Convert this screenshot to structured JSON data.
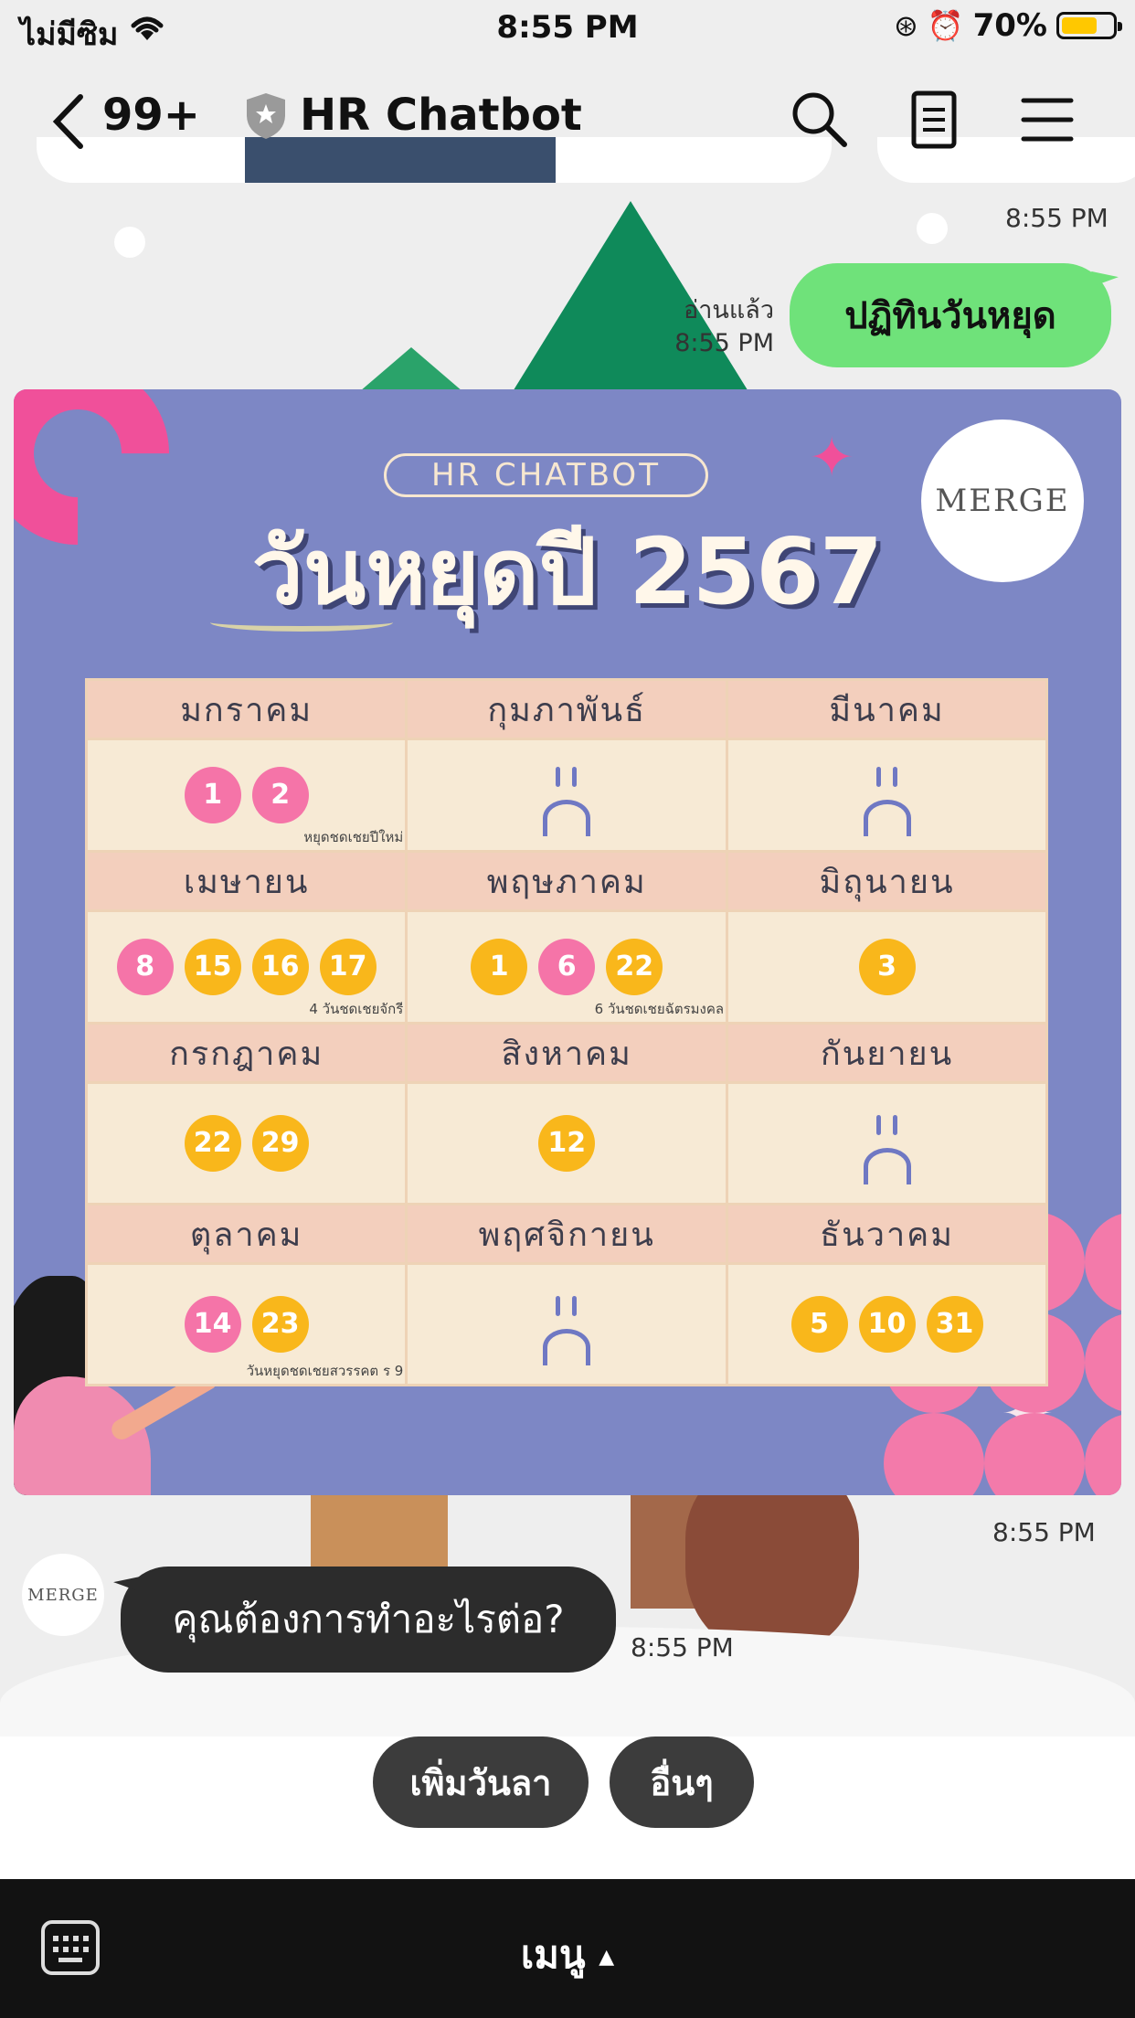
{
  "status_bar": {
    "carrier": "ไม่มีซิม",
    "time": "8:55 PM",
    "battery": "70%",
    "battery_level": 0.7
  },
  "header": {
    "unread_count": "99+",
    "title": "HR Chatbot",
    "icons": [
      "back-icon",
      "shield-icon",
      "search-icon",
      "notes-icon",
      "menu-icon"
    ]
  },
  "chat": {
    "timestamp_top": "8:55 PM",
    "outgoing": {
      "text": "ปฏิทินวันหยุด",
      "read_label": "อ่านแล้ว",
      "time": "8:55 PM"
    },
    "image_time": "8:55 PM",
    "calendar": {
      "badge": "HR CHATBOT",
      "title": "วันหยุดปี 2567",
      "logo": "MERGE",
      "months": [
        {
          "name": "มกราคม",
          "days": [
            {
              "d": "1",
              "c": "pink"
            },
            {
              "d": "2",
              "c": "pink"
            }
          ],
          "note": "หยุดชดเชยปีใหม่"
        },
        {
          "name": "กุมภาพันธ์",
          "days": [],
          "note": ""
        },
        {
          "name": "มีนาคม",
          "days": [],
          "note": ""
        },
        {
          "name": "เมษายน",
          "days": [
            {
              "d": "8",
              "c": "pink"
            },
            {
              "d": "15",
              "c": "yellow"
            },
            {
              "d": "16",
              "c": "yellow"
            },
            {
              "d": "17",
              "c": "yellow"
            }
          ],
          "note": "4 วันชดเชยจักรี"
        },
        {
          "name": "พฤษภาคม",
          "days": [
            {
              "d": "1",
              "c": "yellow"
            },
            {
              "d": "6",
              "c": "pink"
            },
            {
              "d": "22",
              "c": "yellow"
            }
          ],
          "note": "6 วันชดเชยฉัตรมงคล"
        },
        {
          "name": "มิถุนายน",
          "days": [
            {
              "d": "3",
              "c": "yellow"
            }
          ],
          "note": ""
        },
        {
          "name": "กรกฎาคม",
          "days": [
            {
              "d": "22",
              "c": "yellow"
            },
            {
              "d": "29",
              "c": "yellow"
            }
          ],
          "note": ""
        },
        {
          "name": "สิงหาคม",
          "days": [
            {
              "d": "12",
              "c": "yellow"
            }
          ],
          "note": ""
        },
        {
          "name": "กันยายน",
          "days": [],
          "note": ""
        },
        {
          "name": "ตุลาคม",
          "days": [
            {
              "d": "14",
              "c": "pink"
            },
            {
              "d": "23",
              "c": "yellow"
            }
          ],
          "note": "วันหยุดชดเชยสวรรคต ร 9"
        },
        {
          "name": "พฤศจิกายน",
          "days": [],
          "note": ""
        },
        {
          "name": "ธันวาคม",
          "days": [
            {
              "d": "5",
              "c": "yellow"
            },
            {
              "d": "10",
              "c": "yellow"
            },
            {
              "d": "31",
              "c": "yellow"
            }
          ],
          "note": ""
        }
      ]
    },
    "incoming": {
      "avatar_text": "MERGE",
      "text": "คุณต้องการทำอะไรต่อ?",
      "time": "8:55 PM"
    }
  },
  "quick_replies": [
    "เพิ่มวันลา",
    "อื่นๆ"
  ],
  "bottom_bar": {
    "menu_label": "เมนู",
    "menu_arrow": "▲"
  },
  "colors": {
    "outgoing_bubble": "#6fe27a",
    "incoming_bubble": "#2c2c2c",
    "calendar_bg": "#7d87c5",
    "holiday_pink": "#f574a8",
    "holiday_yellow": "#f9b71b"
  }
}
